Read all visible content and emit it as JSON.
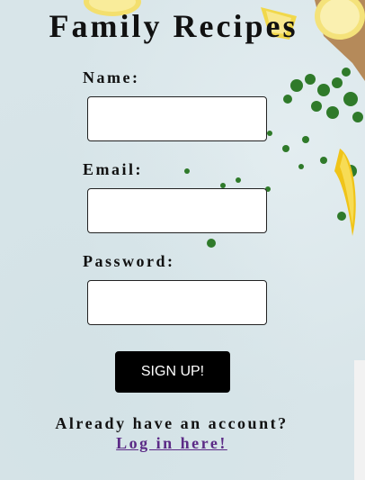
{
  "page": {
    "title": "Family Recipes",
    "name_label": "Name:",
    "email_label": "Email:",
    "password_label": "Password:",
    "name_value": "",
    "email_value": "",
    "password_value": "",
    "signup_button": "SIGN UP!",
    "already_text": "Already have an account?",
    "login_link": "Log in here!"
  },
  "colors": {
    "background": "#d9e6ea",
    "button": "#000000",
    "link": "#5b2a86"
  }
}
